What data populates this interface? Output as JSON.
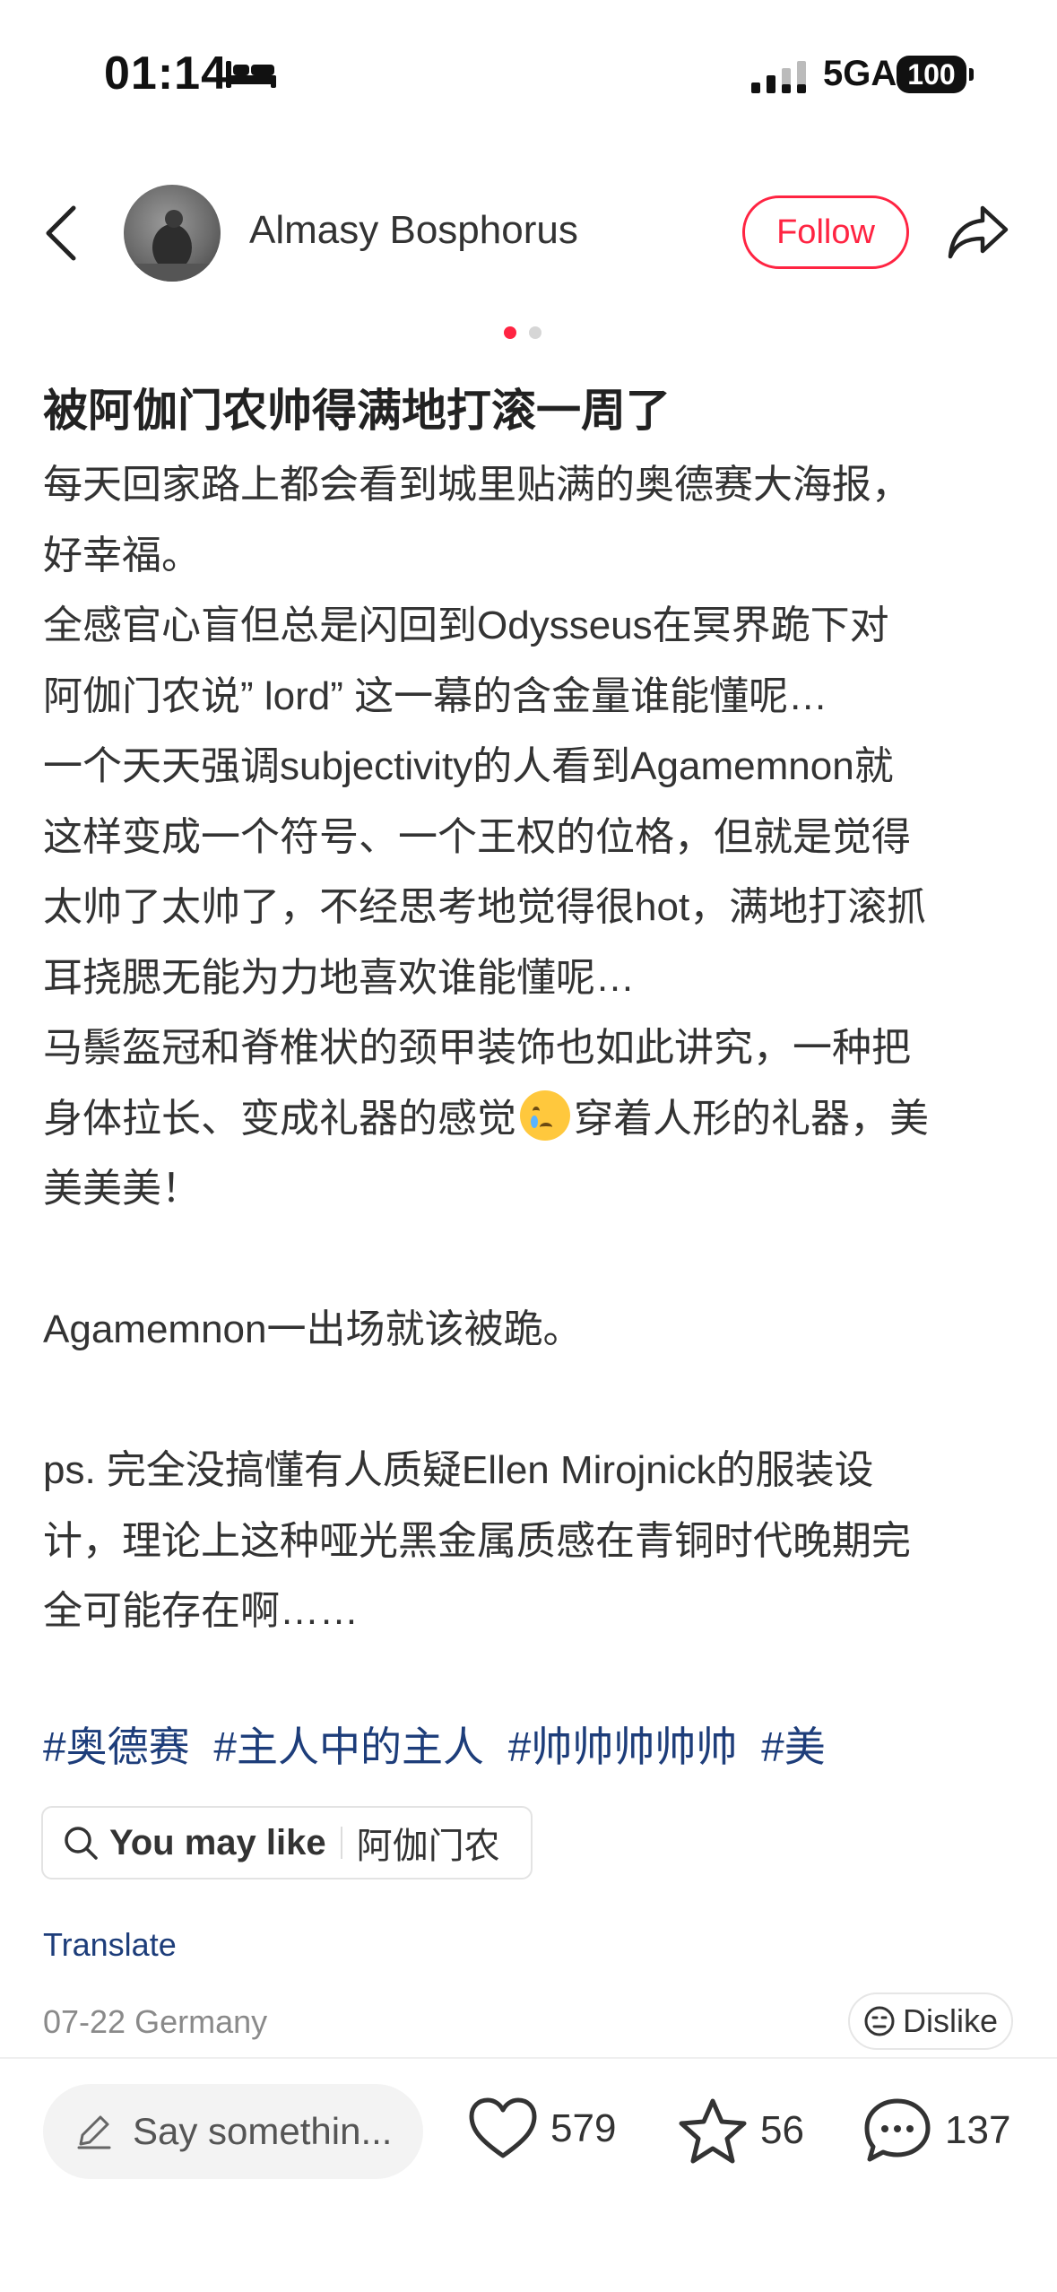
{
  "status_bar": {
    "time": "01:14",
    "network": "5GA",
    "battery": "100"
  },
  "header": {
    "username": "Almasy Bosphorus",
    "follow_label": "Follow"
  },
  "post": {
    "title": "被阿伽门农帅得满地打滚一周了",
    "lines": [
      "每天回家路上都会看到城里贴满的奥德赛大海报，",
      "好幸福。",
      "全感官心盲但总是闪回到Odysseus在冥界跪下对",
      "阿伽门农说” lord” 这一幕的含金量谁能懂呢…",
      "一个天天强调subjectivity的人看到Agamemnon就",
      "这样变成一个符号、一个王权的位格，但就是觉得",
      "太帅了太帅了，不经思考地觉得很hot，满地打滚抓",
      "耳挠腮无能为力地喜欢谁能懂呢…",
      "马鬃盔冠和脊椎状的颈甲装饰也如此讲究，一种把",
      "身体拉长、变成礼器的感觉",
      "美！",
      "",
      "Agamemnon一出场就该被跪。",
      "",
      "ps. 完全没搞懂有人质疑Ellen Mirojnick的服装设",
      "计，理论上这种哑光黑金属质感在青铜时代晚期完",
      "全可能存在啊……"
    ],
    "line10_tail": "穿着人形的礼器，美",
    "line11_head": "美美",
    "tags": [
      "#奥德赛",
      "#主人中的主人",
      "#帅帅帅帅帅",
      "#美"
    ],
    "you_may_like": {
      "label": "You may like",
      "keyword": "阿伽门农"
    },
    "translate_label": "Translate",
    "meta": "07-22 Germany",
    "dislike_label": "Dislike"
  },
  "bottom_bar": {
    "comment_placeholder": "Say somethin...",
    "likes": "579",
    "stars": "56",
    "comments": "137"
  },
  "colors": {
    "accent": "#ff2442",
    "link": "#1d3d7a"
  }
}
